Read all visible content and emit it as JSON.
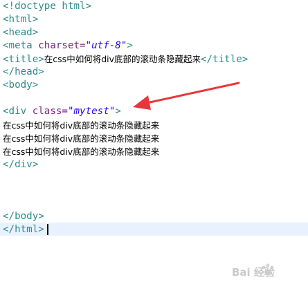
{
  "code": {
    "doctype": "<!doctype html>",
    "html_open": "<html>",
    "head_open": "<head>",
    "meta": {
      "open": "<meta ",
      "attr": "charset=",
      "value": "\"utf-8\"",
      "close": ">"
    },
    "title": {
      "open": "<title>",
      "text": "在css中如何将div底部的滚动条隐藏起来",
      "close": "</title>"
    },
    "head_close": "</head>",
    "body_open": "<body>",
    "div_open": {
      "open": "<div ",
      "attr": "class=",
      "value": "\"mytest\"",
      "close": ">"
    },
    "content_lines": [
      "在css中如何将div底部的滚动条隐藏起来",
      "在css中如何将div底部的滚动条隐藏起来",
      "在css中如何将div底部的滚动条隐藏起来"
    ],
    "div_close": "</div>",
    "body_close": "</body>",
    "html_close": "</html>"
  },
  "annotation": {
    "arrow_color": "#e8363a"
  },
  "watermark": {
    "text": "Bai 经验"
  }
}
